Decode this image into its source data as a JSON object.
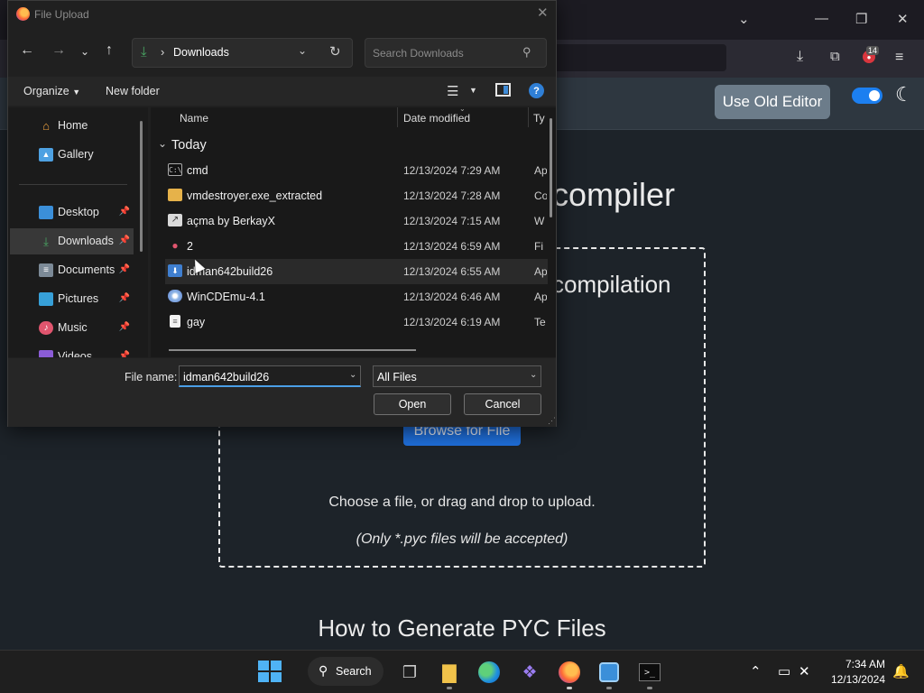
{
  "dialog": {
    "title": "File Upload",
    "address_label": "Downloads",
    "search_placeholder": "Search Downloads",
    "toolbar": {
      "organize": "Organize",
      "new_folder": "New folder"
    },
    "sidebar": [
      {
        "label": "Home",
        "icon": "home-icon",
        "pinned": false
      },
      {
        "label": "Gallery",
        "icon": "gallery-icon",
        "pinned": false
      },
      {
        "label": "Desktop",
        "icon": "desktop-icon",
        "pinned": true
      },
      {
        "label": "Downloads",
        "icon": "downloads-icon",
        "pinned": true,
        "selected": true
      },
      {
        "label": "Documents",
        "icon": "documents-icon",
        "pinned": true
      },
      {
        "label": "Pictures",
        "icon": "pictures-icon",
        "pinned": true
      },
      {
        "label": "Music",
        "icon": "music-icon",
        "pinned": true
      },
      {
        "label": "Videos",
        "icon": "videos-icon",
        "pinned": true
      }
    ],
    "columns": {
      "name": "Name",
      "date": "Date modified",
      "type": "Ty"
    },
    "group_label": "Today",
    "files": [
      {
        "name": "cmd",
        "date": "12/13/2024 7:29 AM",
        "type": "Ap",
        "icon": "cmd-icon"
      },
      {
        "name": "vmdestroyer.exe_extracted",
        "date": "12/13/2024 7:28 AM",
        "type": "Co",
        "icon": "folder-icon"
      },
      {
        "name": "açma by BerkayX",
        "date": "12/13/2024 7:15 AM",
        "type": "W",
        "icon": "shortcut-icon"
      },
      {
        "name": "2",
        "date": "12/13/2024 6:59 AM",
        "type": "Fi",
        "icon": "app-icon"
      },
      {
        "name": "idman642build26",
        "date": "12/13/2024 6:55 AM",
        "type": "Ap",
        "icon": "installer-icon",
        "highlighted": true
      },
      {
        "name": "WinCDEmu-4.1",
        "date": "12/13/2024 6:46 AM",
        "type": "Ap",
        "icon": "disc-icon"
      },
      {
        "name": "gay",
        "date": "12/13/2024 6:19 AM",
        "type": "Te",
        "icon": "text-file-icon"
      }
    ],
    "file_name_label": "File name:",
    "file_name_value": "idman642build26",
    "file_type_value": "All Files",
    "open_label": "Open",
    "cancel_label": "Cancel"
  },
  "browser": {
    "downloads_badge": "14"
  },
  "web": {
    "old_editor_label": "Use Old Editor",
    "heading_partial": "compiler",
    "subheading_partial": "compilation",
    "browse_label": "Browse for File",
    "drop_hint": "Choose a file, or drag and drop to upload.",
    "drop_note": "(Only *.pyc files will be accepted)",
    "section_heading": "How to Generate PYC Files"
  },
  "taskbar": {
    "search_label": "Search",
    "time": "7:34 AM",
    "date": "12/13/2024"
  },
  "colors": {
    "accent": "#1f6fdc",
    "toggle": "#1c7ff0",
    "dialog_bg": "#202020"
  }
}
